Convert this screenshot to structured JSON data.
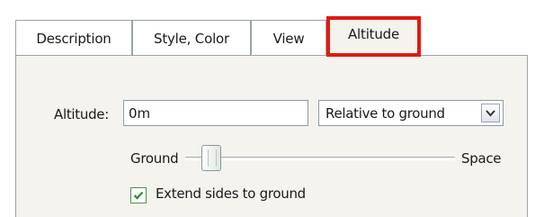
{
  "tabs": [
    {
      "label": "Description"
    },
    {
      "label": "Style, Color"
    },
    {
      "label": "View"
    },
    {
      "label": "Altitude"
    }
  ],
  "active_tab": "Altitude",
  "highlight_color": "#e11b10",
  "altitude": {
    "label": "Altitude:",
    "value": "0m",
    "mode_selected": "Relative to ground"
  },
  "slider": {
    "min_label": "Ground",
    "max_label": "Space",
    "level": 0.07
  },
  "extend_checkbox": {
    "label": "Extend sides to ground",
    "checked": true
  },
  "icons": {
    "select_arrow": "chevron-down-icon",
    "check": "checkmark-icon"
  }
}
